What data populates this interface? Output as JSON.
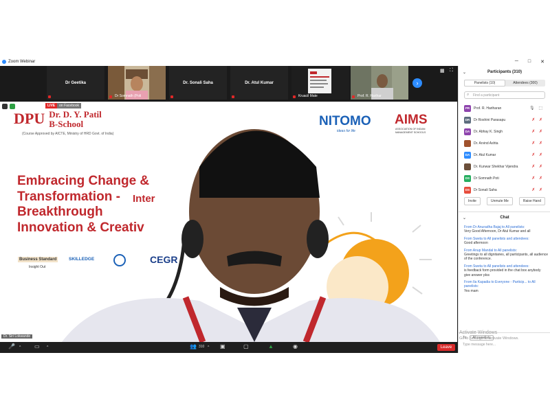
{
  "window": {
    "title": "Zoom Webinar",
    "controls": [
      "─",
      "□",
      "✕"
    ]
  },
  "tiles": [
    {
      "name": "Dr Geetika",
      "label": "",
      "video": false
    },
    {
      "name": "",
      "label": "Dr Somnath (Poli",
      "video": true
    },
    {
      "name": "Dr. Sonali Saha",
      "label": "",
      "video": false
    },
    {
      "name": "Dr. Atul Kumar",
      "label": "",
      "video": false
    },
    {
      "name": "",
      "label": "Kruacil Mate",
      "video": true
    },
    {
      "name": "",
      "label": "Prof. R. Harihar",
      "video": true
    }
  ],
  "stage": {
    "live_badge": "LIVE",
    "live_text": "on Facebook",
    "school_name_line1": "Dr. D. Y. Patil",
    "school_name_line2": "B-School",
    "school_sub": "(Course Approved by AICTE, Ministry of HRD Govt. of India)",
    "logo_text": "DPU",
    "partner_text": "NITOMO",
    "partner_tag": "ideas for life",
    "partner2": "AIMS",
    "partner2_sub": "ASSOCIATION OF INDIAN MANAGEMENT SCHOOLS",
    "inter_title": "Inter",
    "headline": [
      "Embracing Change &",
      "Transformation -",
      "Breakthrough",
      "Innovation & Creativ"
    ],
    "sponsor1": "Business Standard",
    "sponsor1_sub": "Insight Out",
    "sponsor2": "SKILLEDGE",
    "sponsor3": "CEGR",
    "speaker_label": "Dr. Siri Lokwande"
  },
  "toolbar": {
    "leave_label": "Leave",
    "participants_count": "310"
  },
  "participants_panel": {
    "title": "Participants (310)",
    "tab_panelists": "Panelists (10)",
    "tab_attendees": "Attendees (300)",
    "search_placeholder": "Find a participant",
    "rows": [
      {
        "initials": "PR",
        "name": "Prof. R. Hariharan",
        "color": "#8e44ad",
        "icons": "🎙 ⬚"
      },
      {
        "initials": "DR",
        "name": "Dr Roshini Parasapu",
        "color": "#5d6d7e",
        "icons": "✗ ✗"
      },
      {
        "initials": "DA",
        "name": "Dr. Abhay K. Singh",
        "color": "#8e44ad",
        "icons": "✗ ✗"
      },
      {
        "initials": "",
        "name": "Dr. Arvind Ashta",
        "color": "#a0522d",
        "icons": "✗ ✗"
      },
      {
        "initials": "DA",
        "name": "Dr. Atul Kumar",
        "color": "#2d8cff",
        "icons": "✗ ✗"
      },
      {
        "initials": "",
        "name": "Dr. Kunwar Shekhar Vijendra",
        "color": "#6b4f3a",
        "icons": "✗ ✗"
      },
      {
        "initials": "DS",
        "name": "Dr Somnath Poti",
        "color": "#27ae60",
        "icons": "✗ ✗"
      },
      {
        "initials": "DS",
        "name": "Dr Sonali Saha",
        "color": "#e74c3c",
        "icons": "✗ ✗"
      }
    ],
    "invite": "Invite",
    "unmute_me": "Unmute Me",
    "raise_hand": "Raise Hand"
  },
  "chat_panel": {
    "title": "Chat",
    "messages": [
      {
        "from": "From Dr Anuradha Bajaj to All panelists:",
        "text": "Very Good Afternoon, Dr Atul Kumar and all"
      },
      {
        "from": "From Sweta to All panelists and attendees:",
        "text": "Good afternoon"
      },
      {
        "from": "From Anup Mandal to All panelists:",
        "text": "Greetings to all dignitaries, all participants, all audience of the conference."
      },
      {
        "from": "From Sweta to All panelists and attendees:",
        "text": "is feedback form provided in the chat box anybody give answer plss"
      },
      {
        "from": "From Ila Kapadia to Everyone - Particip... to All panelists:",
        "text": "Yes mam"
      }
    ],
    "to_label": "To:",
    "to_value": "All panelists",
    "type_placeholder": "Type message here..."
  },
  "overlay": {
    "activate_line1": "Activate Windows",
    "activate_line2": "Go to Settings to activate Windows."
  }
}
